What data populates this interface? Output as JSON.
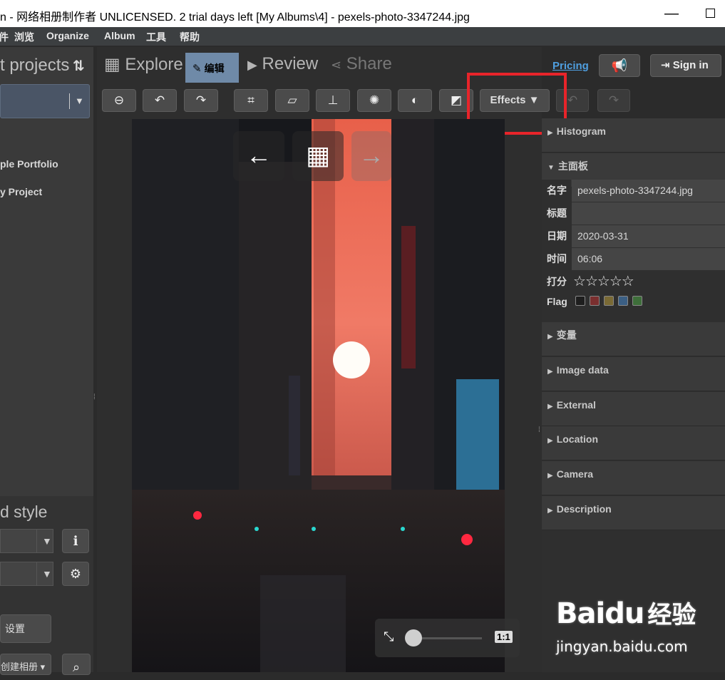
{
  "window": {
    "title": "n - 网络相册制作者 UNLICENSED. 2 trial days left [My Albums\\4] - pexels-photo-3347244.jpg",
    "minimize": "—"
  },
  "menu": [
    "件",
    "浏览",
    "Organize",
    "Album",
    "工具",
    "帮助"
  ],
  "left_panel": {
    "heading": "t projects",
    "items": [
      "ple Portfolio",
      "y Project"
    ],
    "style_heading": "d style",
    "settings_label": "设置",
    "new_album_label": "创建相册 ▾"
  },
  "tabs": {
    "explore": "Explore",
    "edit": "编辑",
    "review": "Review",
    "share": "Share"
  },
  "header": {
    "pricing": "Pricing",
    "sign_in": "Sign in"
  },
  "toolbar": {
    "effects_label": "Effects ▼"
  },
  "viewer": {
    "one_to_one": "1:1"
  },
  "right_panel": {
    "sections": {
      "histogram": "Histogram",
      "main_panel": "主面板",
      "variables": "变量",
      "image_data": "Image data",
      "external": "External",
      "location": "Location",
      "camera": "Camera",
      "description": "Description"
    },
    "props": {
      "name_label": "名字",
      "name_value": "pexels-photo-3347244.jpg",
      "title_label": "标题",
      "title_value": "",
      "date_label": "日期",
      "date_value": "2020-03-31",
      "time_label": "时间",
      "time_value": "06:06",
      "rating_label": "打分",
      "rating_value": 0,
      "flag_label": "Flag"
    },
    "flag_colors": [
      "#1e1e1e",
      "#7a2f2f",
      "#7a6a35",
      "#3b5f84",
      "#3e6e3a"
    ]
  },
  "watermark": {
    "brand": "Baidu",
    "cn": "经验",
    "url": "jingyan.baidu.com"
  },
  "colors": {
    "highlight": "#e8242a",
    "accent_link": "#4f9fe0",
    "edit_tab": "#6f8aa8"
  }
}
